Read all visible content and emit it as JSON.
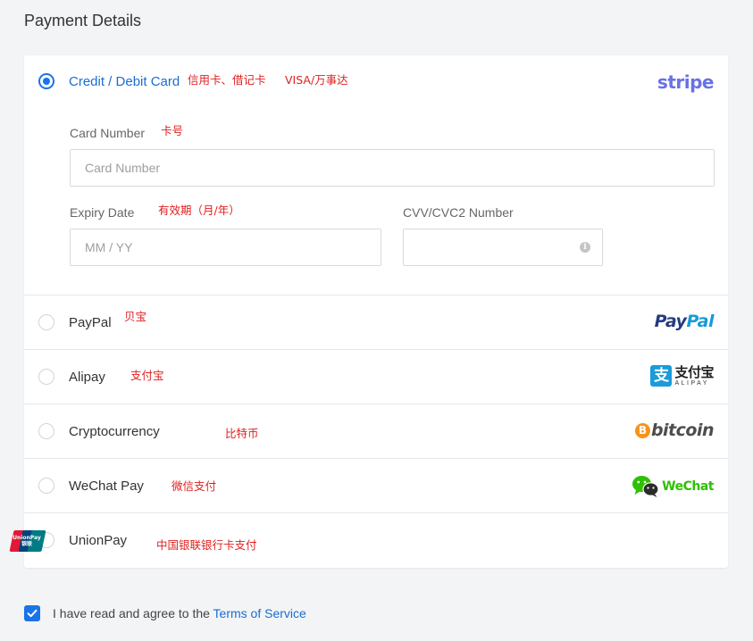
{
  "page": {
    "title": "Payment Details"
  },
  "card": {
    "label": "Credit / Debit Card",
    "note_types": "信用卡、借记卡",
    "note_brands": "VISA/万事达",
    "logo_text": "stripe",
    "card_number": {
      "label": "Card Number",
      "note": "卡号",
      "placeholder": "Card Number"
    },
    "expiry": {
      "label": "Expiry Date",
      "note": "有效期（月/年）",
      "placeholder": "MM / YY"
    },
    "cvv": {
      "label": "CVV/CVC2 Number",
      "placeholder": "",
      "info_glyph": "i"
    }
  },
  "methods": [
    {
      "label": "PayPal",
      "note": "贝宝",
      "logo": "paypal-logo"
    },
    {
      "label": "Alipay",
      "note": "支付宝",
      "logo": "alipay-logo"
    },
    {
      "label": "Cryptocurrency",
      "note": "比特币",
      "logo": "bitcoin-logo"
    },
    {
      "label": "WeChat Pay",
      "note": "微信支付",
      "logo": "wechat-logo"
    },
    {
      "label": "UnionPay",
      "note": "中国银联银行卡支付",
      "logo": "unionpay-logo"
    }
  ],
  "logos": {
    "paypal": {
      "part1": "Pay",
      "part2": "Pal"
    },
    "alipay": {
      "glyph": "支",
      "cn": "支付宝",
      "en": "ALIPAY"
    },
    "bitcoin": {
      "symbol": "B",
      "text": "bitcoin"
    },
    "wechat": {
      "text": "WeChat"
    },
    "unionpay": {
      "line1": "UnionPay",
      "line2": "银联"
    }
  },
  "agreement": {
    "checked": true,
    "text": "I have read and agree to the ",
    "link": "Terms of Service"
  },
  "colors": {
    "accent": "#1a73e8",
    "note_red": "#e02020",
    "stripe": "#6772e5",
    "paypal_dark": "#253b80",
    "paypal_light": "#179bd7",
    "alipay": "#1a9bda",
    "bitcoin": "#f7931a",
    "wechat": "#2dc100"
  }
}
